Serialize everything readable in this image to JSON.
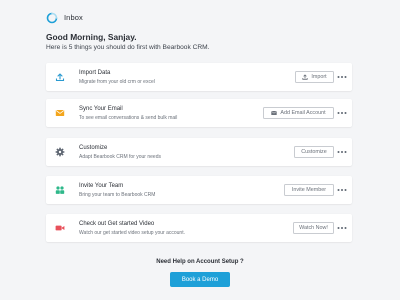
{
  "header": {
    "title": "Inbox",
    "logo_icon": "circular-logo-icon"
  },
  "greeting": "Good Morning, Sanjay.",
  "subtitle": "Here is 5 things you should do first with Bearbook CRM.",
  "colors": {
    "accent": "#1ea0d8",
    "import_icon": "#2b9ad0",
    "email_icon": "#f3a51c",
    "customize_icon": "#5c6470",
    "team_icon": "#2eb88a",
    "video_icon": "#e8505b"
  },
  "tasks": [
    {
      "title": "Import Data",
      "description": "Migrate from your old crm or excel",
      "action_label": "Import",
      "icon": "upload-icon",
      "action_icon": "upload-small-icon"
    },
    {
      "title": "Sync Your Email",
      "description": "To see email conversations & send bulk mail",
      "action_label": "Add Email Account",
      "icon": "envelope-icon",
      "action_icon": "envelope-small-icon"
    },
    {
      "title": "Customize",
      "description": "Adapt Bearbook CRM for your needs",
      "action_label": "Customize",
      "icon": "gear-icon"
    },
    {
      "title": "Invite Your Team",
      "description": "Bring your team to Bearbook CRM",
      "action_label": "Invite Member",
      "icon": "team-icon"
    },
    {
      "title": "Check out Get started Video",
      "description": "Watch our get started video setup your account.",
      "action_label": "Watch Now!",
      "icon": "video-camera-icon"
    }
  ],
  "help": {
    "text": "Need Help on Account Setup ?",
    "button_label": "Book a Demo"
  }
}
